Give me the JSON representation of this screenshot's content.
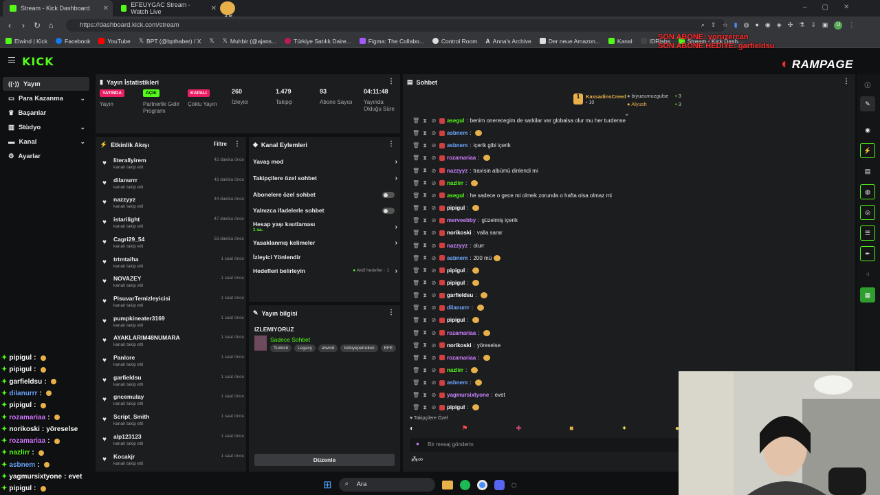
{
  "browser": {
    "tabs": [
      {
        "title": "Stream - Kick Dashboard",
        "active": true
      },
      {
        "title": "EFEUYGAC Stream - Watch Live",
        "active": false
      }
    ],
    "tab_badge": "x15",
    "url": "https://dashboard.kick.com/stream",
    "bookmarks": [
      "Elwind | Kick",
      "Facebook",
      "YouTube",
      "BPT (@bpthaber) / X",
      "Muhbir (@ajans...",
      "Türkiye Satılık Daire...",
      "Figma: The Collabo...",
      "Control Room",
      "Anna's Archive",
      "Der neue Amazon...",
      "Kanal",
      "IDRlabs",
      "Stream - Kick Dash..."
    ]
  },
  "overlay": {
    "last_sub": "SON ABONE: yoruzercan",
    "last_gift": "SON ABONE HEDİYE: garfieldsu",
    "brand": "RAMPAGE"
  },
  "header": {
    "logo": "KICK"
  },
  "sidebar": {
    "items": [
      {
        "label": "Yayın",
        "icon": "broadcast-icon",
        "active": true,
        "chevron": false
      },
      {
        "label": "Para Kazanma",
        "icon": "money-icon",
        "active": false,
        "chevron": true
      },
      {
        "label": "Başarılar",
        "icon": "trophy-icon",
        "active": false,
        "chevron": false
      },
      {
        "label": "Stüdyo",
        "icon": "studio-icon",
        "active": false,
        "chevron": true
      },
      {
        "label": "Kanal",
        "icon": "channel-icon",
        "active": false,
        "chevron": true
      },
      {
        "label": "Ayarlar",
        "icon": "gear-icon",
        "active": false,
        "chevron": false
      }
    ]
  },
  "stats": {
    "title": "Yayın İstatistikleri",
    "items": [
      {
        "badge": "YAYINDA",
        "badge_color": "#e91e63",
        "label": "Yayın"
      },
      {
        "badge": "AÇIK",
        "badge_color": "#53fc18",
        "label": "Partnerlik Gelir Programı"
      },
      {
        "badge": "KAPALI",
        "badge_color": "#e91e63",
        "label": "Çoklu Yayın"
      },
      {
        "value": "260",
        "label": "İzleyici"
      },
      {
        "value": "1.479",
        "label": "Takipçi"
      },
      {
        "value": "93",
        "label": "Abone Sayısı"
      },
      {
        "value": "04:11:48",
        "label": "Yayında Olduğu Süre"
      }
    ]
  },
  "activity": {
    "title": "Etkinlik Akışı",
    "filter": "Filtre",
    "events": [
      {
        "name": "literallyirem",
        "sub": "kanalı takip etti",
        "time": "42 dakika önce"
      },
      {
        "name": "dilanurrr",
        "sub": "kanalı takip etti",
        "time": "43 dakika önce"
      },
      {
        "name": "nazzyyz",
        "sub": "kanalı takip etti",
        "time": "44 dakika önce"
      },
      {
        "name": "istarilight",
        "sub": "kanalı takip etti",
        "time": "47 dakika önce"
      },
      {
        "name": "Cagri29_54",
        "sub": "kanalı takip etti",
        "time": "53 dakika önce"
      },
      {
        "name": "trtmtalha",
        "sub": "kanalı takip etti",
        "time": "1 saat önce"
      },
      {
        "name": "NOVAZEY",
        "sub": "kanalı takip etti",
        "time": "1 saat önce"
      },
      {
        "name": "PisuvarTemizleyicisi",
        "sub": "kanalı takip etti",
        "time": "1 saat önce"
      },
      {
        "name": "pumpkineater3169",
        "sub": "kanalı takip etti",
        "time": "1 saat önce"
      },
      {
        "name": "AYAKLARIM48NUMARA",
        "sub": "kanalı takip etti",
        "time": "1 saat önce"
      },
      {
        "name": "Panlore",
        "sub": "kanalı takip etti",
        "time": "1 saat önce"
      },
      {
        "name": "garfieldsu",
        "sub": "kanalı takip etti",
        "time": "1 saat önce"
      },
      {
        "name": "gncemulay",
        "sub": "kanalı takip etti",
        "time": "1 saat önce"
      },
      {
        "name": "Script_Smith",
        "sub": "kanalı takip etti",
        "time": "1 saat önce"
      },
      {
        "name": "alp123123",
        "sub": "kanalı takip etti",
        "time": "1 saat önce"
      },
      {
        "name": "Kocakjr",
        "sub": "kanalı takip etti",
        "time": "1 saat önce"
      }
    ]
  },
  "channel_actions": {
    "title": "Kanal Eylemleri",
    "rows": [
      {
        "label": "Yavaş mod",
        "control": "arrow"
      },
      {
        "label": "Takipçilere özel sohbet",
        "control": "arrow"
      },
      {
        "label": "Abonelere özel sohbet",
        "control": "toggle"
      },
      {
        "label": "Yalnızca ifadelerle sohbet",
        "control": "toggle"
      },
      {
        "label": "Hesap yaşı kısıtlaması",
        "sub": "1 sa.",
        "control": "arrow"
      },
      {
        "label": "Yasaklanmış kelimeler",
        "control": "arrow"
      },
      {
        "label": "İzleyici Yönlendir",
        "control": "none"
      },
      {
        "label": "Hedefleri belirleyin",
        "status": "Aktif hedefler · 1",
        "control": "arrow"
      }
    ]
  },
  "stream_info": {
    "title": "Yayın bilgisi",
    "stream_title": "IZLEMIYORUZ",
    "category": "Sadece Sohbet",
    "tags": [
      "Turkish",
      "Legacy",
      "elwind",
      "türkiyepetrolleri",
      "EFE"
    ],
    "edit_button": "Düzenle"
  },
  "chat": {
    "title": "Sohbet",
    "top_gifters": [
      {
        "name": "KassadinsCreed",
        "count": "10"
      },
      {
        "name": "biyuzumuzgulse",
        "count": "3"
      },
      {
        "name": "Alyush",
        "count": "3"
      }
    ],
    "messages": [
      {
        "user": "asegul",
        "color": "#53fc18",
        "text": "benim onerecegim de sarkilar var globalsa olur mu her turdense"
      },
      {
        "user": "asbnem",
        "color": "#6ea8ff",
        "text": "",
        "emote": true
      },
      {
        "user": "asbnem",
        "color": "#6ea8ff",
        "text": "içerik gibi içerik"
      },
      {
        "user": "rozamariaa",
        "color": "#d17bff",
        "text": "",
        "emote": true
      },
      {
        "user": "nazzyyz",
        "color": "#c986ff",
        "text": "travisin albümü dinlendi mi"
      },
      {
        "user": "nazlirr",
        "color": "#53fc18",
        "text": "",
        "emote": true
      },
      {
        "user": "asegul",
        "color": "#53fc18",
        "text": "he sadece o gece mi olmek zorunda o hafta olsa olmaz mi"
      },
      {
        "user": "pipigul",
        "color": "#ffffff",
        "text": "",
        "emote": true
      },
      {
        "user": "merveebby",
        "color": "#c986ff",
        "text": "güzelmiş içerik"
      },
      {
        "user": "norikoski",
        "color": "#ffffff",
        "text": "valla sarar"
      },
      {
        "user": "nazzyyz",
        "color": "#c986ff",
        "text": "olurr"
      },
      {
        "user": "asbnem",
        "color": "#6ea8ff",
        "text": "200 mü",
        "emote": true
      },
      {
        "user": "pipigul",
        "color": "#ffffff",
        "text": "",
        "emote": true
      },
      {
        "user": "pipigul",
        "color": "#ffffff",
        "text": "",
        "emote": true
      },
      {
        "user": "garfieldsu",
        "color": "#ffffff",
        "text": "",
        "emote": true
      },
      {
        "user": "dilanurrr",
        "color": "#6ea8ff",
        "text": "",
        "emote": true
      },
      {
        "user": "pipigul",
        "color": "#ffffff",
        "text": "",
        "emote": true
      },
      {
        "user": "rozamariaa",
        "color": "#d17bff",
        "text": "",
        "emote": true
      },
      {
        "user": "norikoski",
        "color": "#ffffff",
        "text": "yöreselse"
      },
      {
        "user": "rozamariaa",
        "color": "#d17bff",
        "text": "",
        "emote": true
      },
      {
        "user": "nazlirr",
        "color": "#53fc18",
        "text": "",
        "emote": true
      },
      {
        "user": "asbnem",
        "color": "#6ea8ff",
        "text": "",
        "emote": true
      },
      {
        "user": "yagmursixtyone",
        "color": "#c986ff",
        "text": "evet"
      },
      {
        "user": "pipigul",
        "color": "#ffffff",
        "text": "",
        "emote": true
      }
    ],
    "followers_only": "Takipçilere Özel",
    "input_placeholder": "Bir mesaj gönderin"
  },
  "overlay_chat": [
    {
      "user": "pipigul",
      "color": "#ffffff",
      "text": ""
    },
    {
      "user": "pipigul",
      "color": "#ffffff",
      "text": ""
    },
    {
      "user": "garfieldsu",
      "color": "#ffffff",
      "text": ""
    },
    {
      "user": "dilanurrr",
      "color": "#6ea8ff",
      "text": ""
    },
    {
      "user": "pipigul",
      "color": "#ffffff",
      "text": ""
    },
    {
      "user": "rozamariaa",
      "color": "#d17bff",
      "text": ""
    },
    {
      "user": "norikoski",
      "color": "#ffffff",
      "text": "yöreselse"
    },
    {
      "user": "rozamariaa",
      "color": "#d17bff",
      "text": ""
    },
    {
      "user": "nazlirr",
      "color": "#53fc18",
      "text": ""
    },
    {
      "user": "asbnem",
      "color": "#6ea8ff",
      "text": ""
    },
    {
      "user": "yagmursixtyone",
      "color": "#ffffff",
      "text": "evet"
    },
    {
      "user": "pipigul",
      "color": "#ffffff",
      "text": ""
    }
  ],
  "taskbar": {
    "search": "Ara"
  }
}
